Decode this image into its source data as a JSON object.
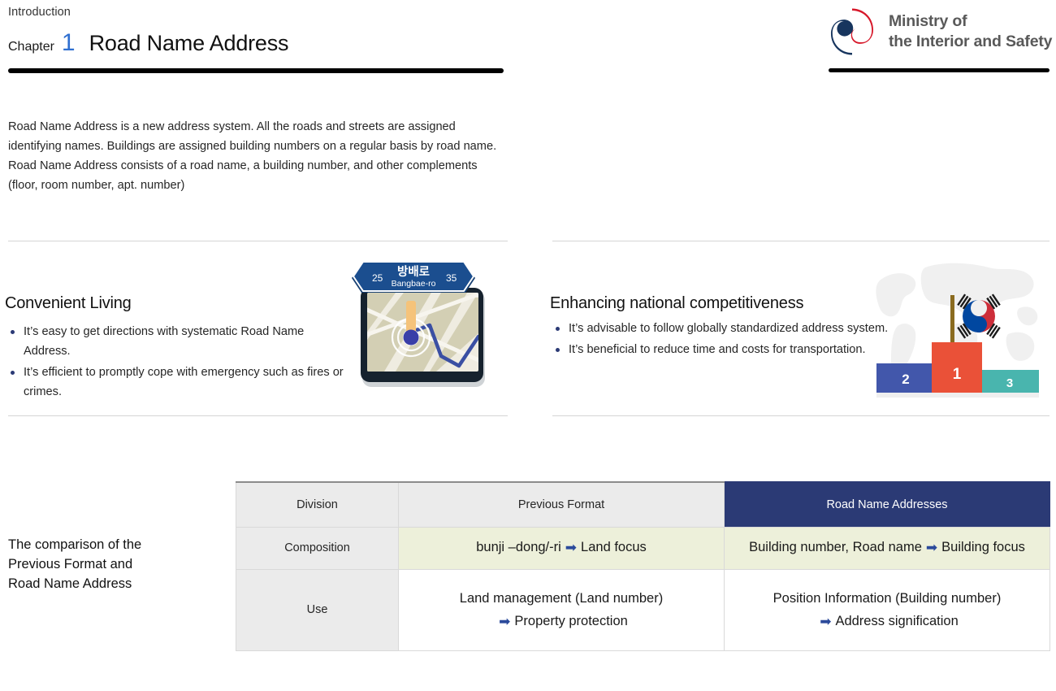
{
  "header": {
    "eyebrow": "Introduction",
    "chapter_word": "Chapter",
    "chapter_number": "1",
    "chapter_title": "Road Name Address",
    "accent_blue": "#2f6fd0",
    "rule_color": "#000000"
  },
  "logo": {
    "name": "ministry-of-interior-and-safety-logo",
    "text": "Ministry of\nthe Interior and Safety",
    "colors": {
      "red": "#d7182a",
      "navy": "#17355e",
      "text": "#595959"
    }
  },
  "intro": {
    "paragraph": "Road Name Address is a new address system. All the roads and streets are assigned\nidentifying names. Buildings are assigned building numbers on a regular basis by road name.\nRoad Name Address consists of a road name, a building number, and other complements\n(floor, room number, apt. number)"
  },
  "features": [
    {
      "title": "Convenient Living",
      "bullets": [
        "It’s easy to get directions with systematic Road Name Address.",
        "It’s efficient to promptly cope with emergency such as fires or crimes."
      ]
    },
    {
      "title": "Enhancing national competitiveness",
      "bullets": [
        "It’s advisable to follow globally standardized address system.",
        "It’s beneficial to reduce time and costs for transportation."
      ]
    }
  ],
  "road_sign": {
    "left_number": "25",
    "road_name_ko": "방배로",
    "road_name_en": "Bangbae-ro",
    "right_number": "35",
    "sign_color": "#1b4e8f"
  },
  "podium": {
    "first_place": "1",
    "second_place": "2",
    "third_place": "3",
    "colors": {
      "first": "#ea5138",
      "second": "#4257ab",
      "third": "#49b5ae",
      "pole": "#8a6b1f"
    },
    "flag": "south-korea-flag"
  },
  "table": {
    "caption": "The comparison of the\nPrevious Format and\nRoad Name Address",
    "headers": [
      "Division",
      "Previous Format",
      "Road Name Addresses"
    ],
    "header_accent": "#2b3a75",
    "rows": [
      {
        "label": "Composition",
        "previous_before": "bunji –dong/-ri",
        "previous_arrow": "➡",
        "previous_after": "Land focus",
        "road_before": "Building number, Road name",
        "road_arrow": "➡",
        "road_after": "Building focus"
      },
      {
        "label": "Use",
        "previous_line1": "Land management (Land number)",
        "previous_arrow": "➡",
        "previous_line2": "Property protection",
        "road_line1": "Position Information (Building number)",
        "road_arrow": "➡",
        "road_line2": "Address signification"
      }
    ]
  }
}
